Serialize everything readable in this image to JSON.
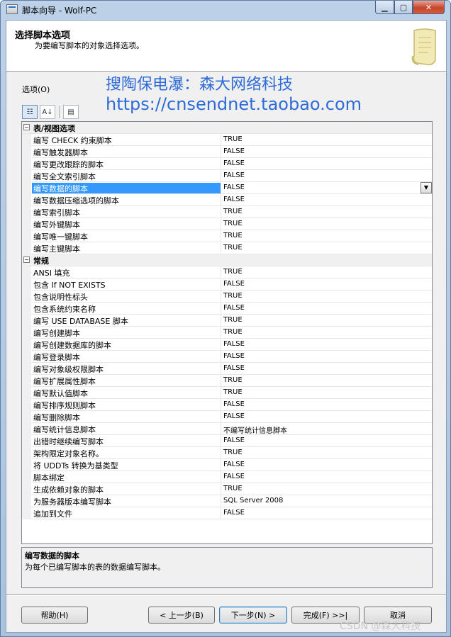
{
  "window": {
    "title": "脚本向导 - Wolf-PC"
  },
  "header": {
    "title": "选择脚本选项",
    "subtitle": "为要编写脚本的对象选择选项。"
  },
  "options_label": "选项(O)",
  "watermark": {
    "line1": "搜陶保电瀑：森大网络科技",
    "line2": "https://cnsendnet.taobao.com"
  },
  "grid": {
    "categories": [
      {
        "label": "表/视图选项",
        "rows": [
          {
            "name": "编写 CHECK 约束脚本",
            "value": "TRUE"
          },
          {
            "name": "编写触发器脚本",
            "value": "FALSE"
          },
          {
            "name": "编写更改跟踪的脚本",
            "value": "FALSE"
          },
          {
            "name": "编写全文索引脚本",
            "value": "FALSE"
          },
          {
            "name": "编写数据的脚本",
            "value": "FALSE",
            "selected": true
          },
          {
            "name": "编写数据压缩选项的脚本",
            "value": "FALSE"
          },
          {
            "name": "编写索引脚本",
            "value": "TRUE"
          },
          {
            "name": "编写外键脚本",
            "value": "TRUE"
          },
          {
            "name": "编写唯一键脚本",
            "value": "TRUE"
          },
          {
            "name": "编写主键脚本",
            "value": "TRUE"
          }
        ]
      },
      {
        "label": "常规",
        "rows": [
          {
            "name": "ANSI 填充",
            "value": "TRUE"
          },
          {
            "name": "包含 If NOT EXISTS",
            "value": "FALSE"
          },
          {
            "name": "包含说明性标头",
            "value": "TRUE"
          },
          {
            "name": "包含系统约束名称",
            "value": "FALSE"
          },
          {
            "name": "编写 USE DATABASE 脚本",
            "value": "TRUE"
          },
          {
            "name": "编写创建脚本",
            "value": "TRUE"
          },
          {
            "name": "编写创建数据库的脚本",
            "value": "FALSE"
          },
          {
            "name": "编写登录脚本",
            "value": "FALSE"
          },
          {
            "name": "编写对象级权限脚本",
            "value": "FALSE"
          },
          {
            "name": "编写扩展属性脚本",
            "value": "TRUE"
          },
          {
            "name": "编写默认值脚本",
            "value": "TRUE"
          },
          {
            "name": "编写排序规则脚本",
            "value": "FALSE"
          },
          {
            "name": "编写删除脚本",
            "value": "FALSE"
          },
          {
            "name": "编写统计信息脚本",
            "value": "不编写统计信息脚本"
          },
          {
            "name": "出错时继续编写脚本",
            "value": "FALSE"
          },
          {
            "name": "架构限定对象名称。",
            "value": "TRUE"
          },
          {
            "name": "将 UDDTs 转换为基类型",
            "value": "FALSE"
          },
          {
            "name": "脚本绑定",
            "value": "FALSE"
          },
          {
            "name": "生成依赖对象的脚本",
            "value": "TRUE"
          },
          {
            "name": "为服务器版本编写脚本",
            "value": "SQL Server 2008"
          },
          {
            "name": "追加到文件",
            "value": "FALSE"
          }
        ]
      }
    ]
  },
  "description": {
    "title": "编写数据的脚本",
    "text": "为每个已编写脚本的表的数据编写脚本。"
  },
  "buttons": {
    "help": "帮助(H)",
    "back": "< 上一步(B)",
    "next": "下一步(N) >",
    "finish": "完成(F) >>|",
    "cancel": "取消"
  },
  "corner_watermark": "CSDN @森大科技",
  "icons": [
    "app-icon",
    "minimize-icon",
    "maximize-icon",
    "close-icon",
    "scroll-icon",
    "categorized-icon",
    "alphabetical-sort-icon",
    "property-pages-icon",
    "dropdown-arrow-icon"
  ]
}
